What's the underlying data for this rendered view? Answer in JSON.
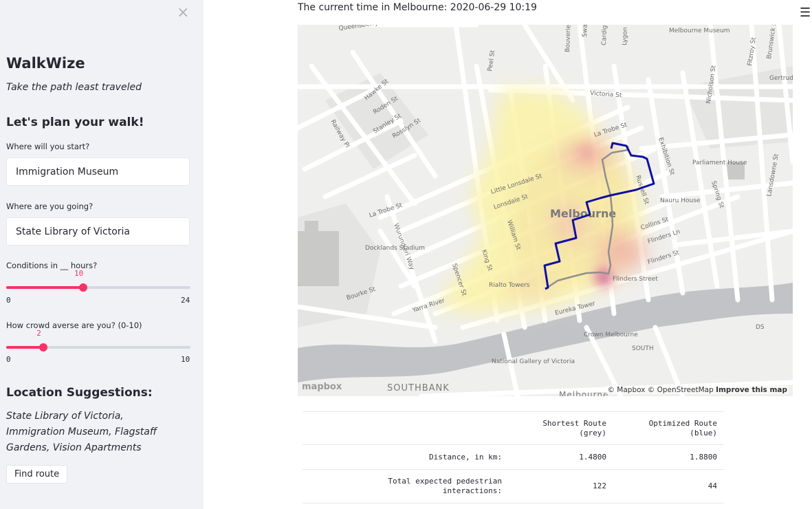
{
  "sidebar": {
    "close_icon": "close-icon",
    "app_title": "WalkWize",
    "tagline": "Take the path least traveled",
    "plan_heading": "Let's plan your walk!",
    "start_label": "Where will you start?",
    "start_value": "Immigration Museum",
    "dest_label": "Where are you going?",
    "dest_value": "State Library of Victoria",
    "hours_label": "Conditions in __ hours?",
    "hours_slider": {
      "value": "10",
      "min": "0",
      "max": "24",
      "fraction": 0.4167
    },
    "crowd_label": "How crowd averse are you? (0-10)",
    "crowd_slider": {
      "value": "2",
      "min": "0",
      "max": "10",
      "fraction": 0.2
    },
    "suggest_heading": "Location Suggestions:",
    "suggest_text": "State Library of Victoria, Immigration Museum, Flagstaff Gardens, Vision Apartments",
    "find_button": "Find route"
  },
  "main": {
    "menu_icon": "hamburger-menu-icon",
    "time_text": "The current time in Melbourne: 2020-06-29 10:19",
    "map": {
      "logo": "mapbox",
      "attribution": "© Mapbox © OpenStreetMap",
      "improve": "Improve this map",
      "labels": [
        "Queensberry St",
        "Peel St",
        "Bouverie St",
        "Swanston St",
        "Cardigan St",
        "Lygon St",
        "Melbourne Museum",
        "Nicholson St",
        "Fitzroy St",
        "Brunswick St",
        "Gertrude St",
        "Hawke St",
        "Roden St",
        "Stanley St",
        "Rosslyn St",
        "Railway Pl",
        "Victoria St",
        "La Trobe St",
        "Exhibition St",
        "Parliament House",
        "Spring St",
        "Lansdowne St",
        "Little Lonsdale St",
        "Lonsdale St",
        "Melbourne",
        "Russell St",
        "Nauru House",
        "Collins St",
        "Flinders Ln",
        "Flinders St",
        "Docklands Stadium",
        "Wurundjeri Way",
        "William St",
        "King St",
        "Spencer St",
        "Rialto Towers",
        "Flinders Street",
        "Bourke St",
        "Yarra River",
        "Eureka Tower",
        "Crown Melbourne",
        "National Gallery of Victoria",
        "SOUTH",
        "SOUTHBANK",
        "Melbourne",
        "DS"
      ],
      "colors": {
        "optimized_route": "#1010a0",
        "shortest_route": "#8f8f8f",
        "heat_low": "#fbf3a6",
        "heat_high": "#e7588e"
      }
    },
    "table": {
      "headers": [
        "",
        "Shortest Route\n(grey)",
        "Optimized Route\n(blue)"
      ],
      "rows": [
        {
          "label": "Distance, in km:",
          "shortest": "1.4800",
          "optimized": "1.8800"
        },
        {
          "label": "Total expected pedestrian\ninteractions:",
          "shortest": "122",
          "optimized": "44"
        }
      ]
    }
  }
}
